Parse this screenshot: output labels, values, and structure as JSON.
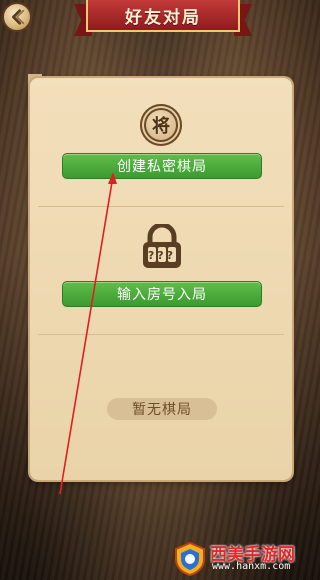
{
  "header": {
    "title": "好友对局",
    "back_icon": "back-arrow-icon"
  },
  "create": {
    "badge_char": "将",
    "button_label": "创建私密棋局"
  },
  "join": {
    "lock_digits": "???",
    "button_label": "输入房号入局"
  },
  "games": {
    "empty_label": "暂无棋局"
  },
  "watermark": {
    "name": "西美手游网",
    "url": "www.hanxm.com"
  },
  "colors": {
    "banner_red": "#b02a2a",
    "button_green": "#4bab3b",
    "panel": "#efdbb5",
    "annotation_arrow": "#e02020"
  }
}
